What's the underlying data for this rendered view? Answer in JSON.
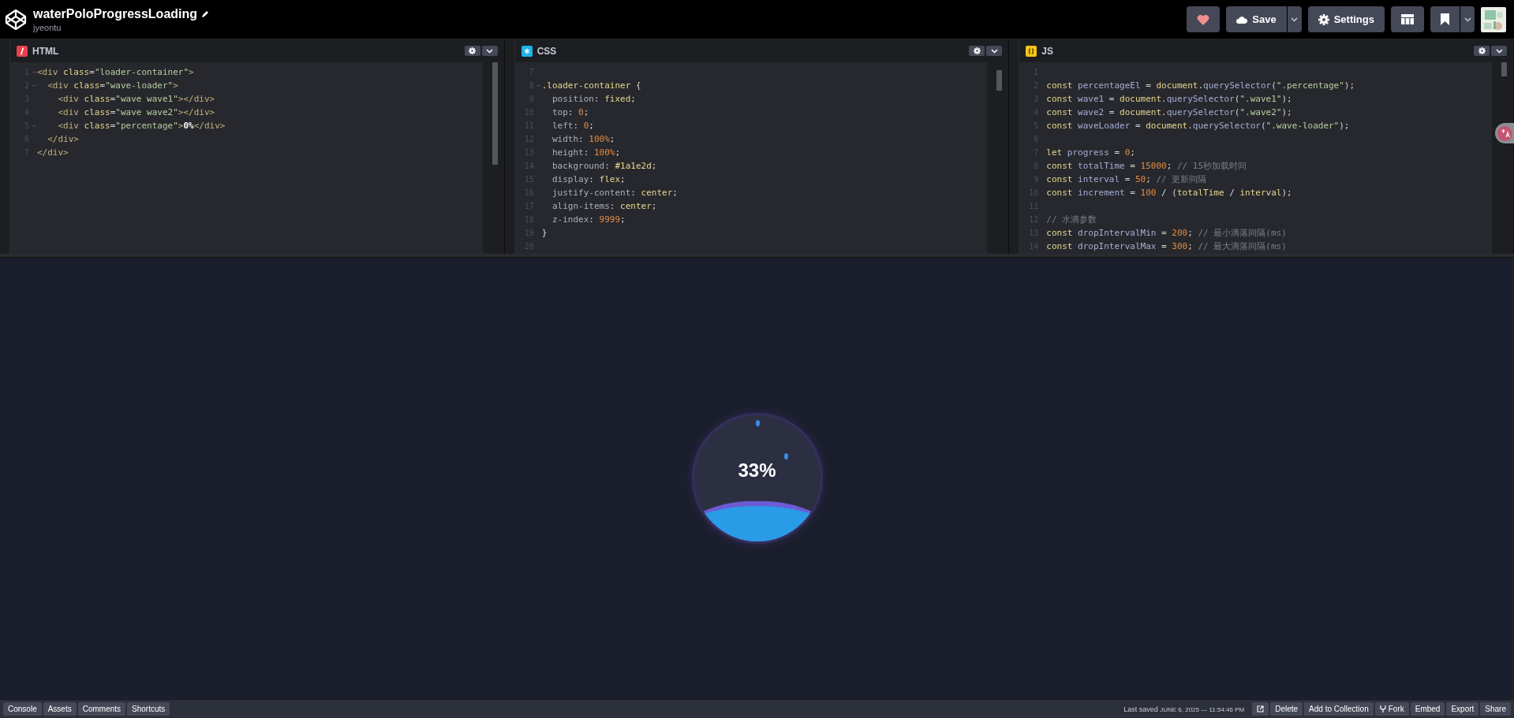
{
  "header": {
    "title": "waterPoloProgressLoading",
    "author": "jyeontu",
    "buttons": [
      {
        "kind": "heart"
      },
      {
        "kind": "save",
        "label": "Save"
      },
      {
        "kind": "settings",
        "label": "Settings"
      },
      {
        "kind": "layout"
      },
      {
        "kind": "bookmark"
      }
    ]
  },
  "editors": [
    {
      "kind": "html",
      "title": "HTML",
      "lines": [
        {
          "n": "1",
          "fold": true,
          "tokens": [
            {
              "kind": "tag",
              "text": "<div"
            },
            {
              "kind": "attr",
              "text": " class"
            },
            {
              "kind": "plain",
              "text": "="
            },
            {
              "kind": "str",
              "text": "\"loader-container\""
            },
            {
              "kind": "tag",
              "text": ">"
            }
          ]
        },
        {
          "n": "2",
          "fold": true,
          "tokens": [
            {
              "kind": "tag",
              "text": "  <div"
            },
            {
              "kind": "attr",
              "text": " class"
            },
            {
              "kind": "plain",
              "text": "="
            },
            {
              "kind": "str",
              "text": "\"wave-loader\""
            },
            {
              "kind": "tag",
              "text": ">"
            }
          ]
        },
        {
          "n": "3",
          "fold": false,
          "tokens": [
            {
              "kind": "tag",
              "text": "    <div"
            },
            {
              "kind": "attr",
              "text": " class"
            },
            {
              "kind": "plain",
              "text": "="
            },
            {
              "kind": "str",
              "text": "\"wave wave1\""
            },
            {
              "kind": "tag",
              "text": "></div>"
            }
          ]
        },
        {
          "n": "4",
          "fold": false,
          "tokens": [
            {
              "kind": "tag",
              "text": "    <div"
            },
            {
              "kind": "attr",
              "text": " class"
            },
            {
              "kind": "plain",
              "text": "="
            },
            {
              "kind": "str",
              "text": "\"wave wave2\""
            },
            {
              "kind": "tag",
              "text": "></div>"
            }
          ]
        },
        {
          "n": "5",
          "fold": true,
          "tokens": [
            {
              "kind": "tag",
              "text": "    <div"
            },
            {
              "kind": "attr",
              "text": " class"
            },
            {
              "kind": "plain",
              "text": "="
            },
            {
              "kind": "str",
              "text": "\"percentage\""
            },
            {
              "kind": "tag",
              "text": ">"
            },
            {
              "kind": "bold",
              "text": "0%"
            },
            {
              "kind": "tag",
              "text": "</div>"
            }
          ]
        },
        {
          "n": "6",
          "fold": false,
          "tokens": [
            {
              "kind": "tag",
              "text": "  </div>"
            }
          ]
        },
        {
          "n": "7",
          "fold": false,
          "tokens": [
            {
              "kind": "tag",
              "text": "</div>"
            }
          ]
        }
      ]
    },
    {
      "kind": "css",
      "title": "CSS",
      "lines": [
        {
          "n": "7",
          "fold": false
        },
        {
          "n": "8",
          "fold": true,
          "tokens": [
            {
              "kind": "sel",
              "text": ".loader-container"
            },
            {
              "kind": "plain",
              "text": " {"
            }
          ]
        },
        {
          "n": "9",
          "fold": false,
          "tokens": [
            {
              "kind": "prop",
              "text": "  position"
            },
            {
              "kind": "plain",
              "text": ": "
            },
            {
              "kind": "val",
              "text": "fixed"
            },
            {
              "kind": "plain",
              "text": ";"
            }
          ]
        },
        {
          "n": "10",
          "fold": false,
          "tokens": [
            {
              "kind": "prop",
              "text": "  top"
            },
            {
              "kind": "plain",
              "text": ": "
            },
            {
              "kind": "num",
              "text": "0"
            },
            {
              "kind": "plain",
              "text": ";"
            }
          ]
        },
        {
          "n": "11",
          "fold": false,
          "tokens": [
            {
              "kind": "prop",
              "text": "  left"
            },
            {
              "kind": "plain",
              "text": ": "
            },
            {
              "kind": "num",
              "text": "0"
            },
            {
              "kind": "plain",
              "text": ";"
            }
          ]
        },
        {
          "n": "12",
          "fold": false,
          "tokens": [
            {
              "kind": "prop",
              "text": "  width"
            },
            {
              "kind": "plain",
              "text": ": "
            },
            {
              "kind": "num",
              "text": "100%"
            },
            {
              "kind": "plain",
              "text": ";"
            }
          ]
        },
        {
          "n": "13",
          "fold": false,
          "tokens": [
            {
              "kind": "prop",
              "text": "  height"
            },
            {
              "kind": "plain",
              "text": ": "
            },
            {
              "kind": "num",
              "text": "100%"
            },
            {
              "kind": "plain",
              "text": ";"
            }
          ]
        },
        {
          "n": "14",
          "fold": false,
          "tokens": [
            {
              "kind": "prop",
              "text": "  background"
            },
            {
              "kind": "plain",
              "text": ": "
            },
            {
              "kind": "val",
              "text": "#1a1e2d"
            },
            {
              "kind": "plain",
              "text": ";"
            }
          ]
        },
        {
          "n": "15",
          "fold": false,
          "tokens": [
            {
              "kind": "prop",
              "text": "  display"
            },
            {
              "kind": "plain",
              "text": ": "
            },
            {
              "kind": "val",
              "text": "flex"
            },
            {
              "kind": "plain",
              "text": ";"
            }
          ]
        },
        {
          "n": "16",
          "fold": false,
          "tokens": [
            {
              "kind": "prop",
              "text": "  justify-content"
            },
            {
              "kind": "plain",
              "text": ": "
            },
            {
              "kind": "val",
              "text": "center"
            },
            {
              "kind": "plain",
              "text": ";"
            }
          ]
        },
        {
          "n": "17",
          "fold": false,
          "tokens": [
            {
              "kind": "prop",
              "text": "  align-items"
            },
            {
              "kind": "plain",
              "text": ": "
            },
            {
              "kind": "val",
              "text": "center"
            },
            {
              "kind": "plain",
              "text": ";"
            }
          ]
        },
        {
          "n": "18",
          "fold": false,
          "tokens": [
            {
              "kind": "prop",
              "text": "  z-index"
            },
            {
              "kind": "plain",
              "text": ": "
            },
            {
              "kind": "num",
              "text": "9999"
            },
            {
              "kind": "plain",
              "text": ";"
            }
          ]
        },
        {
          "n": "19",
          "fold": false,
          "tokens": [
            {
              "kind": "plain",
              "text": "}"
            }
          ]
        },
        {
          "n": "20",
          "fold": false
        }
      ]
    },
    {
      "kind": "js",
      "title": "JS",
      "lines": [
        {
          "n": "1",
          "fold": false
        },
        {
          "n": "2",
          "fold": false,
          "tokens": [
            {
              "kind": "kw",
              "text": "const"
            },
            {
              "kind": "ident",
              "text": " percentageEl"
            },
            {
              "kind": "plain",
              "text": " = "
            },
            {
              "kind": "fn",
              "text": "document"
            },
            {
              "kind": "plain",
              "text": "."
            },
            {
              "kind": "ident",
              "text": "querySelector"
            },
            {
              "kind": "plain",
              "text": "("
            },
            {
              "kind": "str",
              "text": "\".percentage\""
            },
            {
              "kind": "plain",
              "text": ");"
            }
          ]
        },
        {
          "n": "3",
          "fold": false,
          "tokens": [
            {
              "kind": "kw",
              "text": "const"
            },
            {
              "kind": "ident",
              "text": " wave1"
            },
            {
              "kind": "plain",
              "text": " = "
            },
            {
              "kind": "fn",
              "text": "document"
            },
            {
              "kind": "plain",
              "text": "."
            },
            {
              "kind": "ident",
              "text": "querySelector"
            },
            {
              "kind": "plain",
              "text": "("
            },
            {
              "kind": "str",
              "text": "\".wave1\""
            },
            {
              "kind": "plain",
              "text": ");"
            }
          ]
        },
        {
          "n": "4",
          "fold": false,
          "tokens": [
            {
              "kind": "kw",
              "text": "const"
            },
            {
              "kind": "ident",
              "text": " wave2"
            },
            {
              "kind": "plain",
              "text": " = "
            },
            {
              "kind": "fn",
              "text": "document"
            },
            {
              "kind": "plain",
              "text": "."
            },
            {
              "kind": "ident",
              "text": "querySelector"
            },
            {
              "kind": "plain",
              "text": "("
            },
            {
              "kind": "str",
              "text": "\".wave2\""
            },
            {
              "kind": "plain",
              "text": ");"
            }
          ]
        },
        {
          "n": "5",
          "fold": false,
          "tokens": [
            {
              "kind": "kw",
              "text": "const"
            },
            {
              "kind": "ident",
              "text": " waveLoader"
            },
            {
              "kind": "plain",
              "text": " = "
            },
            {
              "kind": "fn",
              "text": "document"
            },
            {
              "kind": "plain",
              "text": "."
            },
            {
              "kind": "ident",
              "text": "querySelector"
            },
            {
              "kind": "plain",
              "text": "("
            },
            {
              "kind": "str",
              "text": "\".wave-loader\""
            },
            {
              "kind": "plain",
              "text": ");"
            }
          ]
        },
        {
          "n": "6",
          "fold": false
        },
        {
          "n": "7",
          "fold": false,
          "tokens": [
            {
              "kind": "kw",
              "text": "let"
            },
            {
              "kind": "ident",
              "text": " progress"
            },
            {
              "kind": "plain",
              "text": " = "
            },
            {
              "kind": "num",
              "text": "0"
            },
            {
              "kind": "plain",
              "text": ";"
            }
          ]
        },
        {
          "n": "8",
          "fold": false,
          "tokens": [
            {
              "kind": "kw",
              "text": "const"
            },
            {
              "kind": "ident",
              "text": " totalTime"
            },
            {
              "kind": "plain",
              "text": " = "
            },
            {
              "kind": "num",
              "text": "15000"
            },
            {
              "kind": "plain",
              "text": ";"
            },
            {
              "kind": "comment",
              "text": " // 15秒加载时间"
            }
          ]
        },
        {
          "n": "9",
          "fold": false,
          "tokens": [
            {
              "kind": "kw",
              "text": "const"
            },
            {
              "kind": "ident",
              "text": " interval"
            },
            {
              "kind": "plain",
              "text": " = "
            },
            {
              "kind": "num",
              "text": "50"
            },
            {
              "kind": "plain",
              "text": ";"
            },
            {
              "kind": "comment",
              "text": " // 更新间隔"
            }
          ]
        },
        {
          "n": "10",
          "fold": false,
          "tokens": [
            {
              "kind": "kw",
              "text": "const"
            },
            {
              "kind": "ident",
              "text": " increment"
            },
            {
              "kind": "plain",
              "text": " = "
            },
            {
              "kind": "num",
              "text": "100"
            },
            {
              "kind": "plain",
              "text": " / ("
            },
            {
              "kind": "fn",
              "text": "totalTime"
            },
            {
              "kind": "plain",
              "text": " / "
            },
            {
              "kind": "fn",
              "text": "interval"
            },
            {
              "kind": "plain",
              "text": ");"
            }
          ]
        },
        {
          "n": "11",
          "fold": false
        },
        {
          "n": "12",
          "fold": false,
          "tokens": [
            {
              "kind": "comment",
              "text": "// 水滴参数"
            }
          ]
        },
        {
          "n": "13",
          "fold": false,
          "tokens": [
            {
              "kind": "kw",
              "text": "const"
            },
            {
              "kind": "ident",
              "text": " dropIntervalMin"
            },
            {
              "kind": "plain",
              "text": " = "
            },
            {
              "kind": "num",
              "text": "200"
            },
            {
              "kind": "plain",
              "text": ";"
            },
            {
              "kind": "comment",
              "text": " // 最小滴落间隔(ms)"
            }
          ]
        },
        {
          "n": "14",
          "fold": false,
          "tokens": [
            {
              "kind": "kw",
              "text": "const"
            },
            {
              "kind": "ident",
              "text": " dropIntervalMax"
            },
            {
              "kind": "plain",
              "text": " = "
            },
            {
              "kind": "num",
              "text": "300"
            },
            {
              "kind": "plain",
              "text": ";"
            },
            {
              "kind": "comment",
              "text": " // 最大滴落间隔(ms)"
            }
          ]
        }
      ]
    }
  ],
  "loader": {
    "percentage": "33%"
  },
  "footer": {
    "left": [
      "Console",
      "Assets",
      "Comments",
      "Shortcuts"
    ],
    "saved_label": "Last saved",
    "saved_time": "JUNE 6, 2025 — 11:54:46 PM",
    "right": [
      {
        "kind": "open"
      },
      {
        "kind": "text",
        "label": "Delete"
      },
      {
        "kind": "text",
        "label": "Add to Collection"
      },
      {
        "kind": "fork",
        "label": "Fork"
      },
      {
        "kind": "text",
        "label": "Embed"
      },
      {
        "kind": "text",
        "label": "Export"
      },
      {
        "kind": "text",
        "label": "Share"
      }
    ]
  }
}
